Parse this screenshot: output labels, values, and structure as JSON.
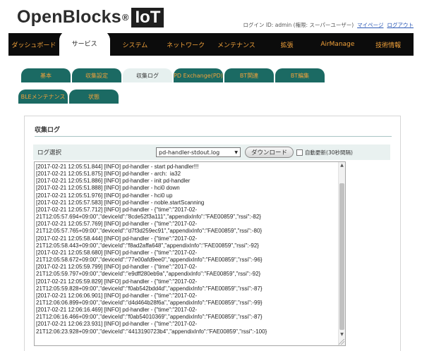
{
  "header": {
    "logo_text": "OpenBlocks",
    "logo_reg": "®",
    "logo_box": "IoT",
    "login_info": "ログイン ID: admin (権限: スーパーユーザー)",
    "mypage_link": "マイページ",
    "logout_link": "ログアウト"
  },
  "main_nav": {
    "items": [
      {
        "label": "ダッシュボード"
      },
      {
        "label": "サービス"
      },
      {
        "label": "システム"
      },
      {
        "label": "ネットワーク"
      },
      {
        "label": "メンテナンス"
      },
      {
        "label": "拡張"
      },
      {
        "label": "AirManage"
      },
      {
        "label": "技術情報"
      }
    ],
    "active_index": 1
  },
  "sub_tabs": {
    "row1": [
      {
        "label": "基本"
      },
      {
        "label": "収集設定"
      },
      {
        "label": "収集ログ"
      },
      {
        "label": "PD Exchange(PD)"
      },
      {
        "label": "BT関連"
      },
      {
        "label": "BT編集"
      }
    ],
    "row2": [
      {
        "label": "BLEメンテナンス"
      },
      {
        "label": "状態"
      }
    ],
    "active": "収集ログ"
  },
  "panel": {
    "title": "収集ログ",
    "log_select_label": "ログ選択",
    "selected_log": "pd-handler-stdout.log",
    "download_button": "ダウンロード",
    "auto_update_label": "自動更新(30秒間隔)",
    "auto_update_checked": false,
    "log_lines": [
      "[2017-02-21 12:05:51.844] [INFO] pd-handler - start pd-handler!!!",
      "[2017-02-21 12:05:51.875] [INFO] pd-handler - arch:  ia32",
      "[2017-02-21 12:05:51.886] [INFO] pd-handler - init pd-handler",
      "[2017-02-21 12:05:51.888] [INFO] pd-handler - hci0 down",
      "[2017-02-21 12:05:51.976] [INFO] pd-handler - hci0 up",
      "[2017-02-21 12:05:57.583] [INFO] pd-handler - noble.startScanning",
      "[2017-02-21 12:05:57.712] [INFO] pd-handler - {\"time\":\"2017-02-",
      "21T12:05:57.694+09:00\",\"deviceId\":\"8cde52f3a111\",\"appendixInfo\":\"FAE00859\",\"rssi\":-82}",
      "[2017-02-21 12:05:57.769] [INFO] pd-handler - {\"time\":\"2017-02-",
      "21T12:05:57.765+09:00\",\"deviceId\":\"d7f3d259ec91\",\"appendixInfo\":\"FAE00859\",\"rssi\":-80}",
      "[2017-02-21 12:05:58.444] [INFO] pd-handler - {\"time\":\"2017-02-",
      "21T12:05:58.443+09:00\",\"deviceId\":\"f8ad2affa648\",\"appendixInfo\":\"FAE00859\",\"rssi\":-92}",
      "[2017-02-21 12:05:58.680] [INFO] pd-handler - {\"time\":\"2017-02-",
      "21T12:05:58.672+09:00\",\"deviceId\":\"77e00afd9ee0\",\"appendixInfo\":\"FAE00859\",\"rssi\":-96}",
      "[2017-02-21 12:05:59.799] [INFO] pd-handler - {\"time\":\"2017-02-",
      "21T12:05:59.797+09:00\",\"deviceId\":\"e9dff280eb9a\",\"appendixInfo\":\"FAE00859\",\"rssi\":-92}",
      "[2017-02-21 12:05:59.829] [INFO] pd-handler - {\"time\":\"2017-02-",
      "21T12:05:59.828+09:00\",\"deviceId\":\"f0ab542bdd4d\",\"appendixInfo\":\"FAE00859\",\"rssi\":-87}",
      "[2017-02-21 12:06:06.901] [INFO] pd-handler - {\"time\":\"2017-02-",
      "21T12:06:06.899+09:00\",\"deviceId\":\"d4d464b28f6a\",\"appendixInfo\":\"FAE00859\",\"rssi\":-99}",
      "[2017-02-21 12:06:16.469] [INFO] pd-handler - {\"time\":\"2017-02-",
      "21T12:06:16.466+09:00\",\"deviceId\":\"f0ab54010369\",\"appendixInfo\":\"FAE00859\",\"rssi\":-87}",
      "[2017-02-21 12:06:23.931] [INFO] pd-handler - {\"time\":\"2017-02-",
      "21T12:06:23.928+09:00\",\"deviceId\":\"4413190723b4\",\"appendixInfo\":\"FAE00859\",\"rssi\":-100}"
    ]
  },
  "icons": {
    "select_caret": "▼",
    "scroll_up": "▲",
    "scroll_down": "▼"
  },
  "colors": {
    "nav_bg": "#0c0c0c",
    "nav_text": "#f2a23a",
    "tab_bg": "#1b6a63",
    "tab_active_bg": "#e6f0ef",
    "link": "#2b58b5"
  }
}
